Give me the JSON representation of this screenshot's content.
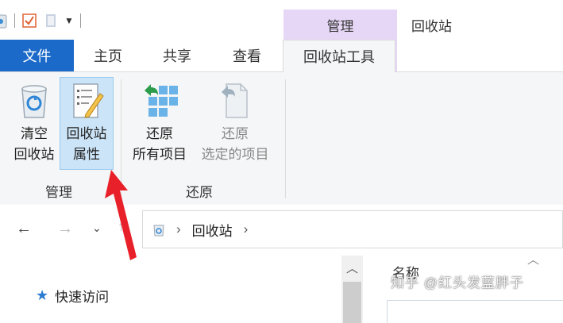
{
  "titlebar": {
    "manage_tab": "管理",
    "window_title": "回收站"
  },
  "tabs": {
    "file": "文件",
    "home": "主页",
    "share": "共享",
    "view": "查看",
    "recycle_tools": "回收站工具"
  },
  "ribbon": {
    "empty": {
      "line1": "清空",
      "line2": "回收站"
    },
    "properties": {
      "line1": "回收站",
      "line2": "属性"
    },
    "restore_all": {
      "line1": "还原",
      "line2": "所有项目"
    },
    "restore_selected": {
      "line1": "还原",
      "line2": "选定的项目"
    },
    "group_manage": "管理",
    "group_restore": "还原"
  },
  "navbar": {
    "address_location": "回收站"
  },
  "content": {
    "column_name": "名称",
    "quick_access": "快速访问"
  },
  "watermark": "知乎 @红头发蓝胖子",
  "colors": {
    "file_tab": "#1b6ac9",
    "manage_tab": "#e7d7f6",
    "selection": "#cce4f7",
    "arrow": "#e8202a"
  }
}
